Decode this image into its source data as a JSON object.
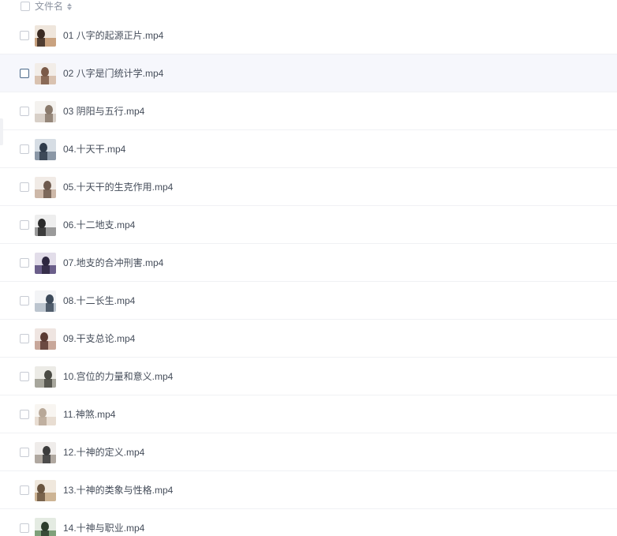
{
  "header": {
    "column_label": "文件名",
    "sort_icon": "sort-updown-icon"
  },
  "files": [
    {
      "name": "01 八字的起源正片.mp4",
      "thumb_colors": [
        "#3a2a22",
        "#c9a27f",
        "#efe6dc"
      ]
    },
    {
      "name": "02 八字是门统计学.mp4",
      "thumb_colors": [
        "#7b5a48",
        "#d9c2b0",
        "#f2ede8"
      ]
    },
    {
      "name": "03 阴阳与五行.mp4",
      "thumb_colors": [
        "#8a7a6c",
        "#d8d0c8",
        "#f4f2ef"
      ]
    },
    {
      "name": "04.十天干.mp4",
      "thumb_colors": [
        "#2f3b4a",
        "#8a97a6",
        "#d6dde4"
      ]
    },
    {
      "name": "05.十天干的生克作用.mp4",
      "thumb_colors": [
        "#6e5a4e",
        "#cdb8a8",
        "#f1ebe6"
      ]
    },
    {
      "name": "06.十二地支.mp4",
      "thumb_colors": [
        "#2a2a2a",
        "#9a9a9a",
        "#eeeeee"
      ]
    },
    {
      "name": "07.地支的合冲刑害.mp4",
      "thumb_colors": [
        "#2e2740",
        "#6b5f8a",
        "#e2dde9"
      ]
    },
    {
      "name": "08.十二长生.mp4",
      "thumb_colors": [
        "#3d4a5a",
        "#bcc5cf",
        "#f3f4f6"
      ]
    },
    {
      "name": "09.干支总论.mp4",
      "thumb_colors": [
        "#5a3a32",
        "#c8a79a",
        "#efe5e1"
      ]
    },
    {
      "name": "10.宫位的力量和意义.mp4",
      "thumb_colors": [
        "#4a4a44",
        "#a7a69c",
        "#ecebe6"
      ]
    },
    {
      "name": "11.神煞.mp4",
      "thumb_colors": [
        "#b8a898",
        "#e8ddd2",
        "#f8f5f1"
      ]
    },
    {
      "name": "12.十神的定义.mp4",
      "thumb_colors": [
        "#3c3c3c",
        "#b0a8a0",
        "#efecea"
      ]
    },
    {
      "name": "13.十神的类象与性格.mp4",
      "thumb_colors": [
        "#6a5540",
        "#cdb494",
        "#f0e8dd"
      ]
    },
    {
      "name": "14.十神与职业.mp4",
      "thumb_colors": [
        "#2d3d2d",
        "#7fa07a",
        "#e4ebe2"
      ]
    }
  ],
  "hovered_row_index": 1
}
